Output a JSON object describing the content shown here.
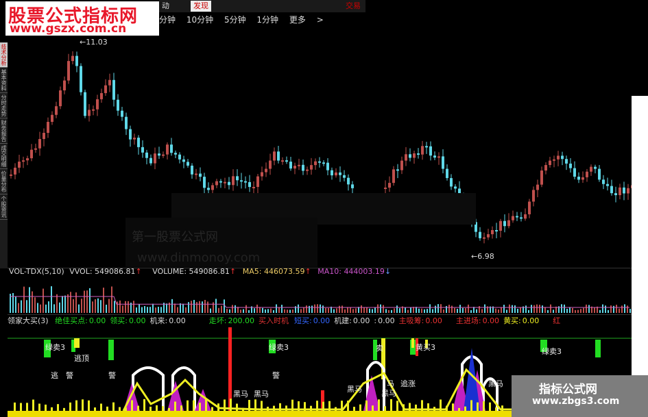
{
  "watermark_top": {
    "title": "股票公式指标网",
    "url": "www.gszx.com.cn"
  },
  "tabs": [
    {
      "label": "动",
      "active": false
    },
    {
      "label": "发现",
      "active": true
    },
    {
      "label": "交易",
      "active": false
    }
  ],
  "periods": [
    "分钟",
    "10分钟",
    "5分钟",
    "1分钟",
    "更多",
    ">"
  ],
  "sidebar": [
    "技术分析",
    "基本资料",
    "分时走势",
    "财务报告",
    "成交明细",
    "价量分布",
    "个股资讯"
  ],
  "price_labels": {
    "high": "11.03",
    "low": "6.98"
  },
  "ghost_watermark": {
    "line1": "第一股票公式网",
    "line2": "www.dinmonoy.com"
  },
  "volume_header": {
    "name": "VOL-TDX(5,10)",
    "vvol_label": "VVOL:",
    "vvol_value": "549086.81",
    "volume_label": "VOLUME:",
    "volume_value": "549086.81",
    "ma5_label": "MA5:",
    "ma5_value": "446073.59",
    "ma10_label": "MA10:",
    "ma10_value": "444003.19"
  },
  "signal_header": {
    "name": "领家大买(3)",
    "items": [
      {
        "label": "绝佳买点:",
        "value": "0.00",
        "color": "#22dd22"
      },
      {
        "label": "领买:",
        "value": "0.00",
        "color": "#22dd22"
      },
      {
        "label": "机来:",
        "value": "0.00",
        "color": "#dddddd"
      },
      {
        "label": "走坏:",
        "value": "200.00",
        "color": "#22dd22"
      },
      {
        "label": "买入时机",
        "value": "",
        "color": "#dd3333"
      },
      {
        "label": "短买:",
        "value": "0.00",
        "color": "#3366ff"
      },
      {
        "label": "机建:",
        "value": "0.00",
        "color": "#dddddd"
      },
      {
        "label": ":",
        "value": "0.00",
        "color": "#dddddd"
      },
      {
        "label": "主吸筹:",
        "value": "0.00",
        "color": "#ee3333"
      },
      {
        "label": "主进场:",
        "value": "0.00",
        "color": "#ee3333"
      },
      {
        "label": "黄买:",
        "value": "0.00",
        "color": "#eeee22"
      },
      {
        "label": "红",
        "value": "",
        "color": "#ee3333"
      }
    ]
  },
  "signal_labels": [
    "绿卖3",
    "逃顶",
    "逃",
    "警",
    "警",
    "绿卖3",
    "警",
    "黄买3",
    "绿卖3",
    "卖",
    "黑马",
    "黑马",
    "黑马",
    "马",
    "追涨",
    "黑马",
    "黑马"
  ],
  "brand_bottom": {
    "title": "指标公式网",
    "url": "www.zbgs3.com"
  },
  "colors": {
    "up": "#c0504d",
    "down": "#5fd8e8",
    "ma": "#d060c0",
    "signal_green": "#22dd22",
    "signal_yellow": "#eeee22",
    "signal_red": "#ff2222"
  }
}
